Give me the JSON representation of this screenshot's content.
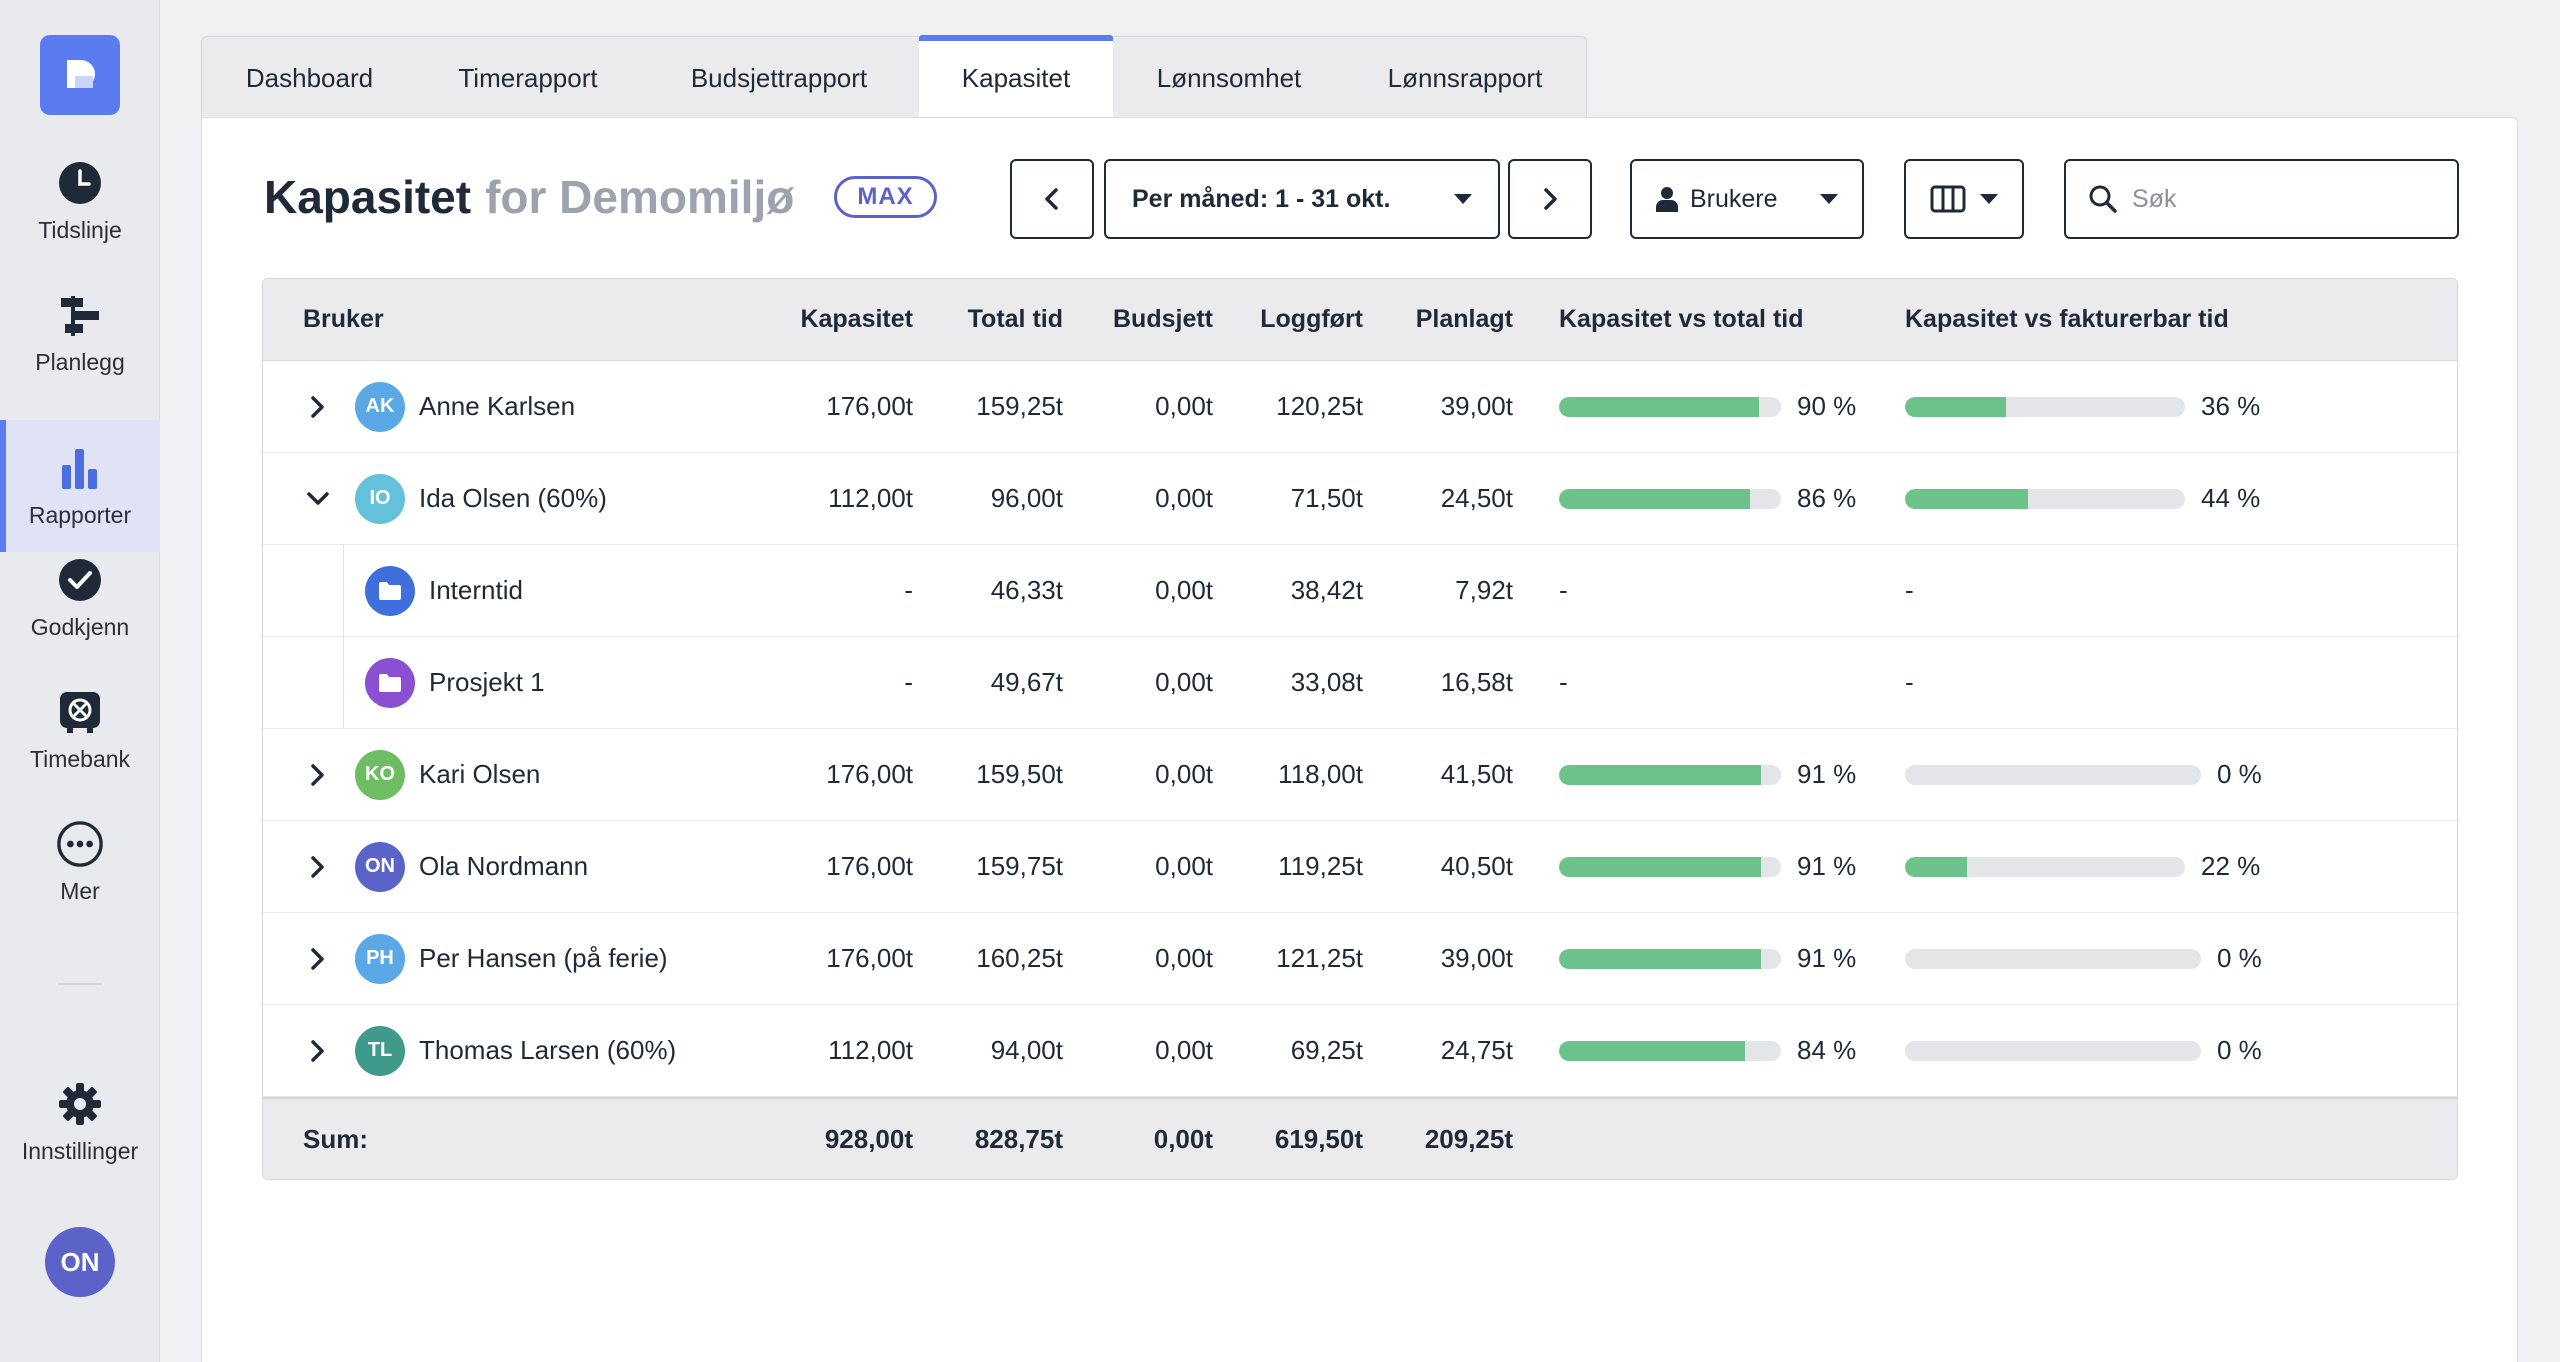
{
  "sidebar": {
    "items": [
      {
        "label": "Tidslinje",
        "icon": "clock-icon"
      },
      {
        "label": "Planlegg",
        "icon": "plan-icon"
      },
      {
        "label": "Rapporter",
        "icon": "bar-chart-icon",
        "active": true
      },
      {
        "label": "Godkjenn",
        "icon": "check-circle-icon"
      },
      {
        "label": "Timebank",
        "icon": "timebank-icon"
      },
      {
        "label": "Mer",
        "icon": "more-icon"
      }
    ],
    "settings_label": "Innstillinger",
    "user_initials": "ON"
  },
  "tabs": [
    "Dashboard",
    "Timerapport",
    "Budsjettrapport",
    "Kapasitet",
    "Lønnsomhet",
    "Lønnsrapport"
  ],
  "active_tab": "Kapasitet",
  "header": {
    "title": "Kapasitet",
    "subtitle": "for Demomiljø",
    "badge": "MAX",
    "period_label": "Per måned: 1 - 31 okt.",
    "users_label": "Brukere",
    "search_placeholder": "Søk"
  },
  "table": {
    "columns": [
      "Bruker",
      "Kapasitet",
      "Total tid",
      "Budsjett",
      "Loggført",
      "Planlagt",
      "Kapasitet vs total tid",
      "Kapasitet vs fakturerbar tid"
    ],
    "rows": [
      {
        "type": "user",
        "expanded": false,
        "initials": "AK",
        "color": "#5aa9e6",
        "name": "Anne Karlsen",
        "kapasitet": "176,00t",
        "total": "159,25t",
        "budsjett": "0,00t",
        "logget": "120,25t",
        "planlagt": "39,00t",
        "kap_total": 90,
        "kap_total_label": "90 %",
        "kap_fakt": 36,
        "kap_fakt_label": "36 %"
      },
      {
        "type": "user",
        "expanded": true,
        "initials": "IO",
        "color": "#63c1dc",
        "name": "Ida Olsen (60%)",
        "kapasitet": "112,00t",
        "total": "96,00t",
        "budsjett": "0,00t",
        "logget": "71,50t",
        "planlagt": "24,50t",
        "kap_total": 86,
        "kap_total_label": "86 %",
        "kap_fakt": 44,
        "kap_fakt_label": "44 %"
      },
      {
        "type": "sub",
        "folder_color": "#3f6fdc",
        "name": "Interntid",
        "kapasitet": "-",
        "total": "46,33t",
        "budsjett": "0,00t",
        "logget": "38,42t",
        "planlagt": "7,92t",
        "kap_total_label": "-",
        "kap_fakt_label": "-"
      },
      {
        "type": "sub",
        "folder_color": "#8a4fd3",
        "name": "Prosjekt 1",
        "kapasitet": "-",
        "total": "49,67t",
        "budsjett": "0,00t",
        "logget": "33,08t",
        "planlagt": "16,58t",
        "kap_total_label": "-",
        "kap_fakt_label": "-"
      },
      {
        "type": "user",
        "expanded": false,
        "initials": "KO",
        "color": "#6dbd63",
        "name": "Kari Olsen",
        "kapasitet": "176,00t",
        "total": "159,50t",
        "budsjett": "0,00t",
        "logget": "118,00t",
        "planlagt": "41,50t",
        "kap_total": 91,
        "kap_total_label": "91 %",
        "kap_fakt": 0,
        "kap_fakt_label": "0 %"
      },
      {
        "type": "user",
        "expanded": false,
        "initials": "ON",
        "color": "#5b63c9",
        "name": "Ola Nordmann",
        "kapasitet": "176,00t",
        "total": "159,75t",
        "budsjett": "0,00t",
        "logget": "119,25t",
        "planlagt": "40,50t",
        "kap_total": 91,
        "kap_total_label": "91 %",
        "kap_fakt": 22,
        "kap_fakt_label": "22 %"
      },
      {
        "type": "user",
        "expanded": false,
        "initials": "PH",
        "color": "#5aa9e6",
        "name": "Per Hansen (på ferie)",
        "kapasitet": "176,00t",
        "total": "160,25t",
        "budsjett": "0,00t",
        "logget": "121,25t",
        "planlagt": "39,00t",
        "kap_total": 91,
        "kap_total_label": "91 %",
        "kap_fakt": 0,
        "kap_fakt_label": "0 %"
      },
      {
        "type": "user",
        "expanded": false,
        "initials": "TL",
        "color": "#3f9a8c",
        "name": "Thomas Larsen (60%)",
        "kapasitet": "112,00t",
        "total": "94,00t",
        "budsjett": "0,00t",
        "logget": "69,25t",
        "planlagt": "24,75t",
        "kap_total": 84,
        "kap_total_label": "84 %",
        "kap_fakt": 0,
        "kap_fakt_label": "0 %"
      }
    ],
    "sum": {
      "label": "Sum:",
      "kapasitet": "928,00t",
      "total": "828,75t",
      "budsjett": "0,00t",
      "logget": "619,50t",
      "planlagt": "209,25t"
    }
  }
}
